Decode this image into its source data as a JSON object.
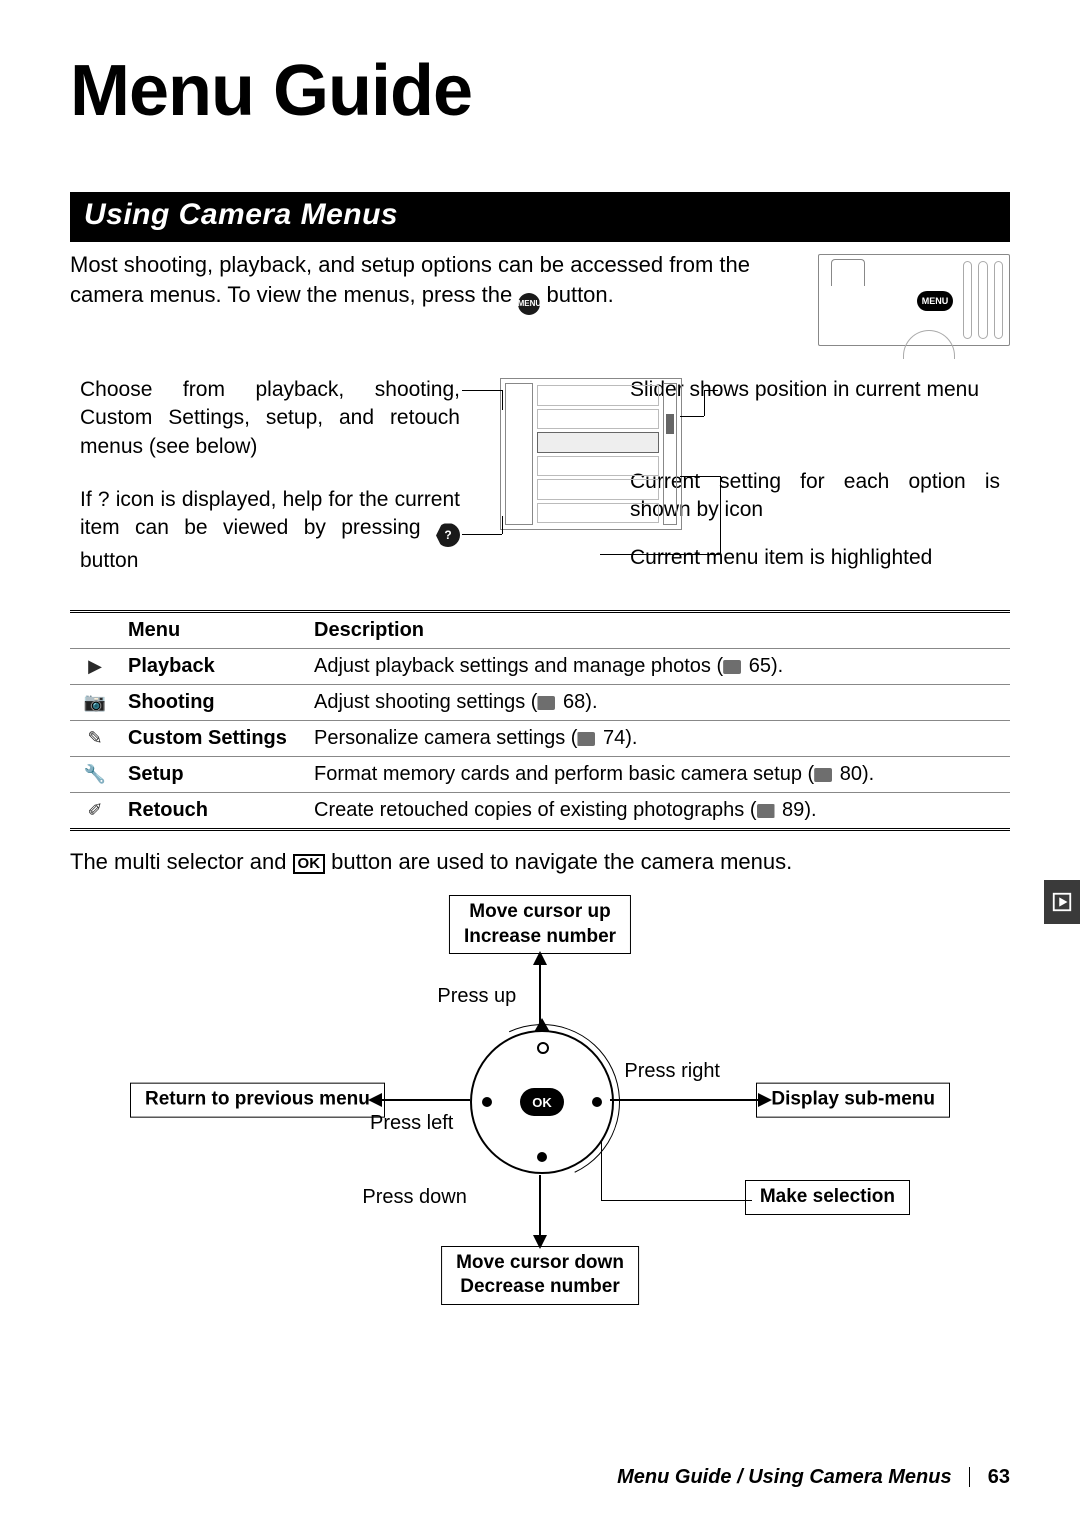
{
  "title": "Menu Guide",
  "section_heading": "Using Camera Menus",
  "intro_pre": "Most shooting, playback, and setup options can be accessed from the camera menus.  To view the menus, press the ",
  "intro_post": " button.",
  "menu_button_label": "MENU",
  "callouts": {
    "left1": "Choose from playback, shooting, Custom Settings, setup, and retouch menus (see below)",
    "left2_pre": "If  ?  icon is displayed, help for the current item can be viewed by pressing",
    "left2_post": " button",
    "right1": "Slider shows position in current menu",
    "right2": "Current setting for each option is shown by icon",
    "right3": "Current menu item is highlighted"
  },
  "table": {
    "head_menu": "Menu",
    "head_desc": "Description",
    "rows": [
      {
        "icon": "playback-icon",
        "glyph": "▶",
        "name": "Playback",
        "desc": "Adjust playback settings and manage photos (",
        "page": "65",
        "tail": ")."
      },
      {
        "icon": "shooting-icon",
        "glyph": "📷",
        "name": "Shooting",
        "desc": "Adjust shooting settings (",
        "page": "68",
        "tail": ")."
      },
      {
        "icon": "custom-icon",
        "glyph": "✎",
        "name": "Custom Settings",
        "desc": "Personalize camera settings (",
        "page": "74",
        "tail": ")."
      },
      {
        "icon": "setup-icon",
        "glyph": "🔧",
        "name": "Setup",
        "desc": "Format memory cards and perform basic camera setup (",
        "page": "80",
        "tail": ")."
      },
      {
        "icon": "retouch-icon",
        "glyph": "✐",
        "name": "Retouch",
        "desc": "Create retouched copies of existing photographs (",
        "page": "89",
        "tail": ")."
      }
    ]
  },
  "selector_intro_pre": "The multi selector and ",
  "selector_intro_mid": "",
  "selector_intro_post": " button are used to navigate the camera menus.",
  "selector": {
    "ok_label": "OK",
    "up_box_l1": "Move cursor up",
    "up_box_l2": "Increase number",
    "down_box_l1": "Move cursor down",
    "down_box_l2": "Decrease number",
    "left_box": "Return to previous menu",
    "right_box": "Display sub-menu",
    "make_selection": "Make selection",
    "press_up": "Press up",
    "press_down": "Press down",
    "press_left": "Press left",
    "press_right": "Press right"
  },
  "footer": {
    "path": "Menu Guide / Using Camera Menus",
    "page_number": "63"
  },
  "side_tab_name": "playback-section-tab"
}
